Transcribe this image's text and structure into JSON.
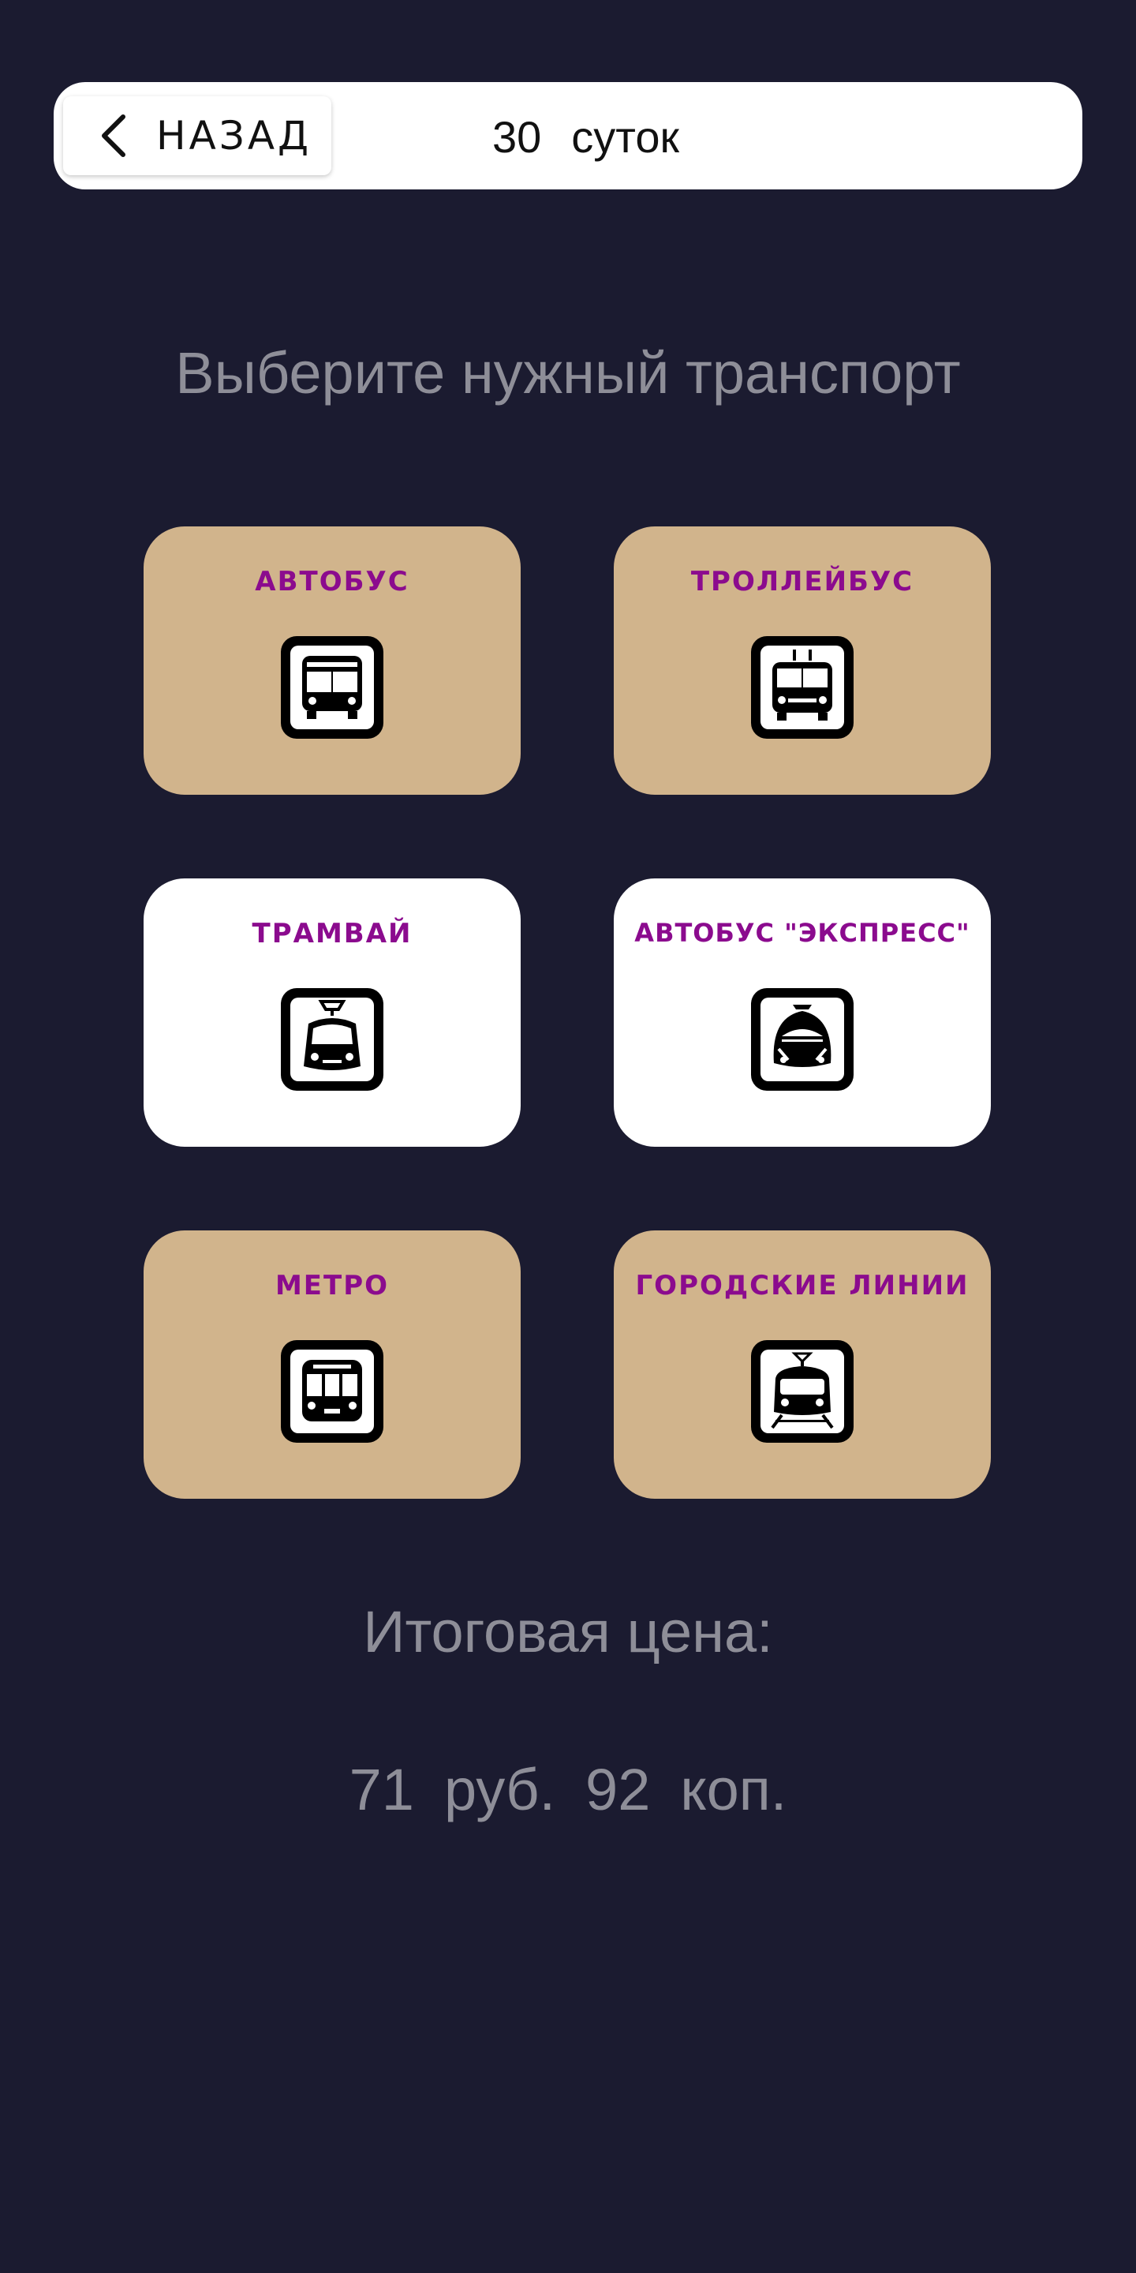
{
  "header": {
    "back_label": "НАЗАД",
    "period_value": "30",
    "period_unit": "суток"
  },
  "main": {
    "heading": "Выберите нужный транспорт",
    "cards": [
      {
        "label": "АВТОБУС",
        "icon": "bus-icon",
        "background": "#d1b48c",
        "selected": false
      },
      {
        "label": "ТРОЛЛЕЙБУС",
        "icon": "trolleybus-icon",
        "background": "#d1b48c",
        "selected": false
      },
      {
        "label": "ТРАМВАЙ",
        "icon": "tram-icon",
        "background": "#ffffff",
        "selected": true
      },
      {
        "label": "АВТОБУС \"ЭКСПРЕСС\"",
        "icon": "express-bus-icon",
        "background": "#ffffff",
        "selected": true
      },
      {
        "label": "МЕТРО",
        "icon": "metro-icon",
        "background": "#d1b48c",
        "selected": false
      },
      {
        "label": "ГОРОДСКИЕ ЛИНИИ",
        "icon": "city-train-icon",
        "background": "#d1b48c",
        "selected": false
      }
    ]
  },
  "total": {
    "label": "Итоговая цена:",
    "rub": "71",
    "rub_unit": "руб.",
    "kop": "92",
    "kop_unit": "коп."
  },
  "colors": {
    "background": "#1b1b30",
    "card_beige": "#d1b48c",
    "card_selected": "#ffffff",
    "card_title": "#8b0b8e",
    "muted_text": "#8e8e98"
  }
}
